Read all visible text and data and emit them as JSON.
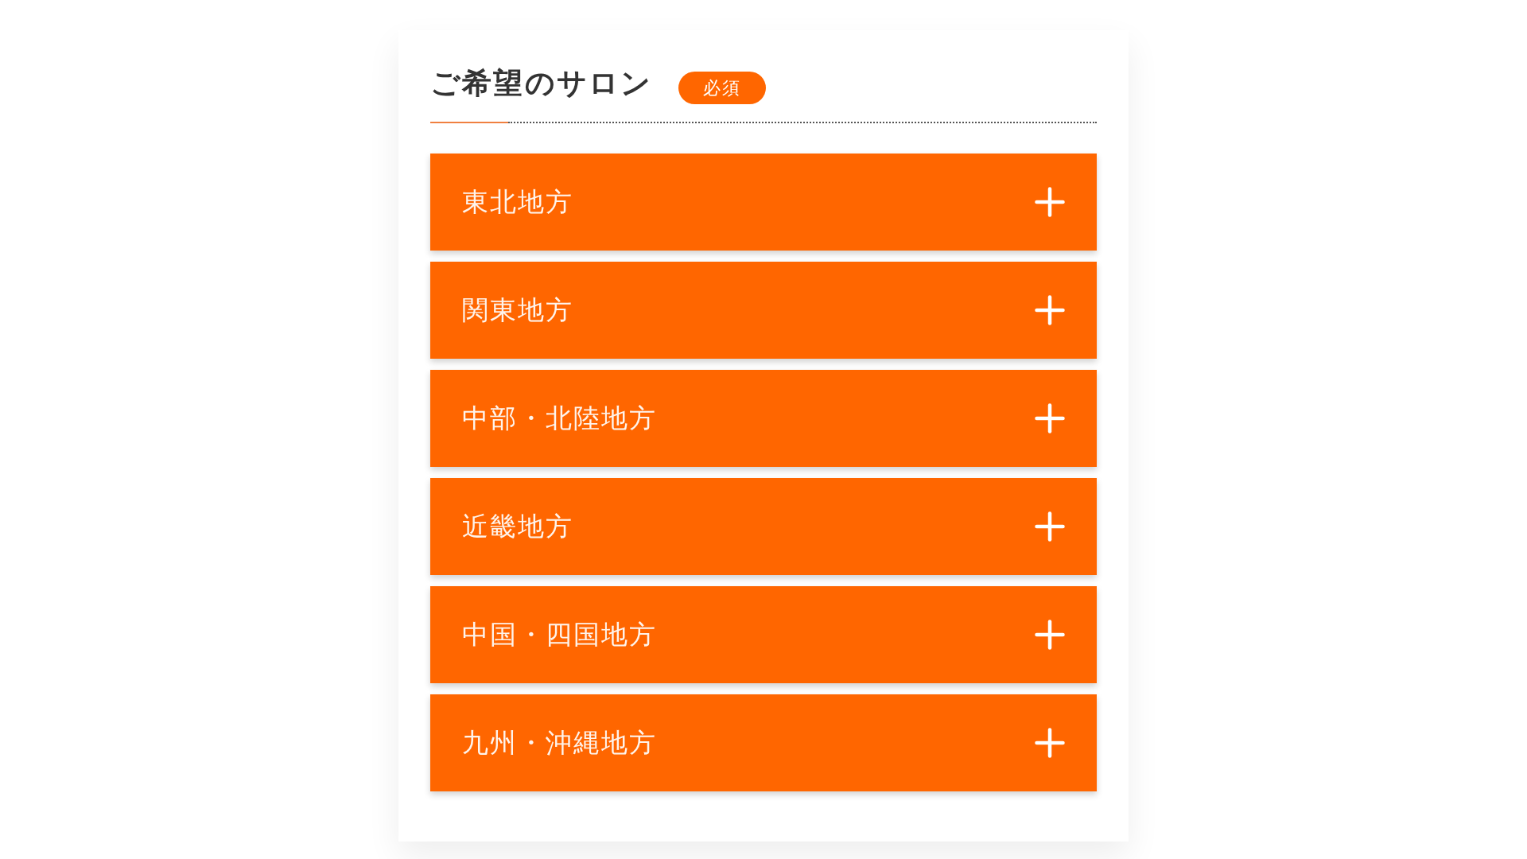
{
  "section": {
    "title": "ご希望のサロン",
    "badge": "必須"
  },
  "regions": [
    {
      "label": "東北地方",
      "expanded": false
    },
    {
      "label": "関東地方",
      "expanded": false
    },
    {
      "label": "中部・北陸地方",
      "expanded": false
    },
    {
      "label": "近畿地方",
      "expanded": false
    },
    {
      "label": "中国・四国地方",
      "expanded": false
    },
    {
      "label": "九州・沖縄地方",
      "expanded": false
    }
  ]
}
